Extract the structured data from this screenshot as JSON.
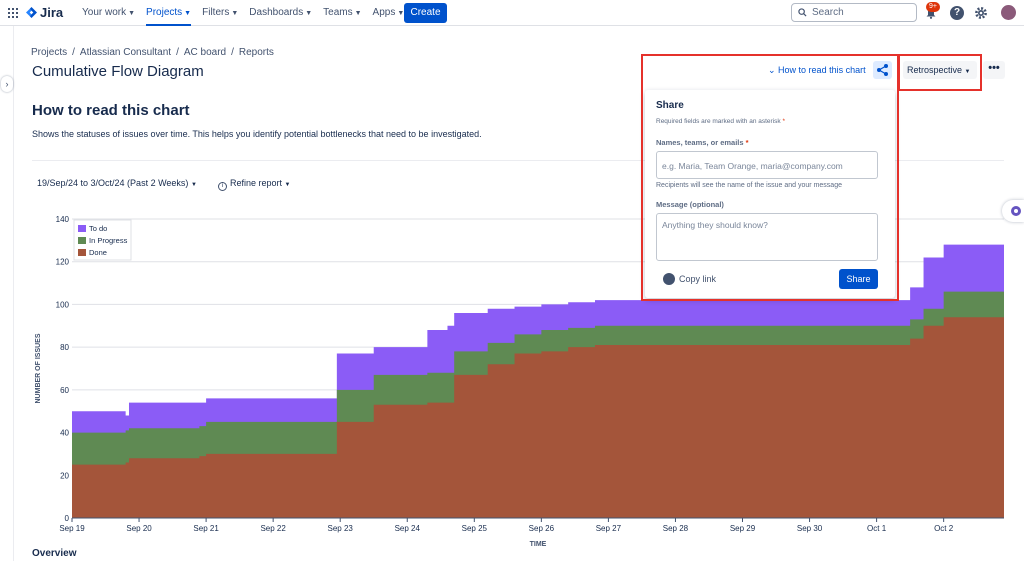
{
  "nav": {
    "logo": "Jira",
    "items": [
      {
        "label": "Your work",
        "active": false
      },
      {
        "label": "Projects",
        "active": true
      },
      {
        "label": "Filters",
        "active": false
      },
      {
        "label": "Dashboards",
        "active": false
      },
      {
        "label": "Teams",
        "active": false
      },
      {
        "label": "Apps",
        "active": false
      }
    ],
    "create": "Create",
    "search_placeholder": "Search",
    "notif_badge": "9+",
    "help": "?"
  },
  "breadcrumb": [
    "Projects",
    "Atlassian Consultant",
    "AC board",
    "Reports"
  ],
  "page_title": "Cumulative Flow Diagram",
  "section_title": "How to read this chart",
  "section_desc": "Shows the statuses of issues over time. This helps you identify potential bottlenecks that need to be investigated.",
  "filters": {
    "date_range": "19/Sep/24 to 3/Oct/24 (Past 2 Weeks)",
    "refine": "Refine report",
    "info_glyph": "i"
  },
  "header_actions": {
    "how_to_read": "How to read this chart",
    "retro": "Retrospective",
    "more": "•••"
  },
  "share_popup": {
    "title": "Share",
    "required_note": "Required fields are marked with an asterisk",
    "asterisk": "*",
    "names_label": "Names, teams, or emails",
    "names_placeholder": "e.g. Maria, Team Orange, maria@company.com",
    "names_help": "Recipients will see the name of the issue and your message",
    "message_label": "Message (optional)",
    "message_placeholder": "Anything they should know?",
    "copy_link": "Copy link",
    "share_button": "Share"
  },
  "overview": "Overview",
  "colors": {
    "todo": "#8b5cf6",
    "in_progress": "#5f8a53",
    "done": "#a4553a",
    "accent": "#0052cc",
    "highlight": "#e5312b"
  },
  "chart_data": {
    "type": "area",
    "ylabel": "NUMBER OF ISSUES",
    "xlabel": "TIME",
    "ylim": [
      0,
      140
    ],
    "yticks": [
      "0",
      "20",
      "40",
      "60",
      "80",
      "100",
      "120",
      "140"
    ],
    "xticks": [
      "Sep 19",
      "Sep 20",
      "Sep 21",
      "Sep 22",
      "Sep 23",
      "Sep 24",
      "Sep 25",
      "Sep 26",
      "Sep 27",
      "Sep 28",
      "Sep 29",
      "Sep 30",
      "Oct 1",
      "Oct 2"
    ],
    "grid": true,
    "legend_position": "top-left",
    "x": [
      0,
      0.8,
      0.85,
      1.9,
      2.0,
      3.9,
      3.95,
      4.5,
      5.0,
      5.3,
      5.6,
      5.7,
      6.2,
      6.6,
      7.0,
      7.4,
      7.8,
      8.5,
      9.5,
      10.5,
      11.0,
      11.5,
      12.0,
      12.5,
      12.7,
      13.0,
      13.9
    ],
    "series": [
      {
        "name": "Done",
        "values": [
          25,
          26,
          28,
          29,
          30,
          30,
          45,
          53,
          53,
          54,
          54,
          67,
          72,
          77,
          78,
          80,
          81,
          81,
          81,
          81,
          81,
          81,
          81,
          84,
          90,
          94,
          95
        ]
      },
      {
        "name": "In Progress",
        "values": [
          40,
          41,
          42,
          43,
          45,
          45,
          60,
          67,
          67,
          68,
          68,
          78,
          82,
          86,
          88,
          89,
          90,
          90,
          90,
          90,
          90,
          90,
          90,
          93,
          98,
          106,
          107
        ]
      },
      {
        "name": "To do",
        "values": [
          50,
          48,
          54,
          54,
          56,
          56,
          77,
          80,
          80,
          88,
          90,
          96,
          98,
          99,
          100,
          101,
          102,
          102,
          102,
          102,
          102,
          102,
          102,
          108,
          122,
          128,
          131
        ]
      }
    ]
  }
}
